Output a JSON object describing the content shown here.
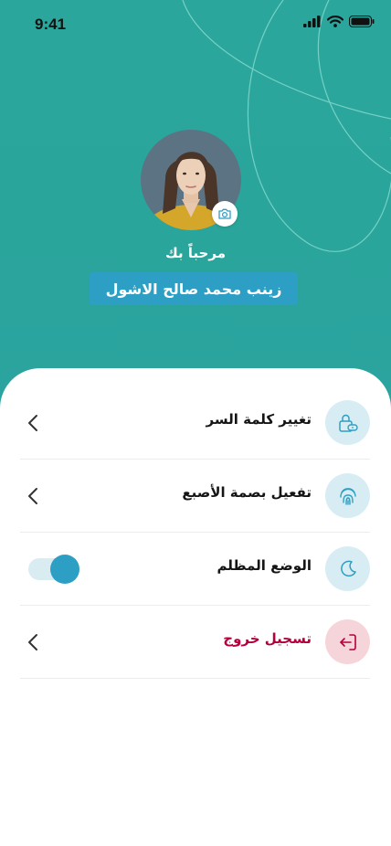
{
  "status_bar": {
    "time": "9:41"
  },
  "profile": {
    "welcome": "مرحباً بك",
    "name": "زينب محمد صالح الاشول"
  },
  "menu": {
    "items": [
      {
        "label": "تغيير كلمة السر",
        "icon": "lock-icon",
        "action": "chevron"
      },
      {
        "label": "تفعيل بصمة الأصبع",
        "icon": "fingerprint-icon",
        "action": "chevron"
      },
      {
        "label": "الوضع المظلم",
        "icon": "moon-icon",
        "action": "toggle",
        "toggle_on": true
      },
      {
        "label": "تسجيل خروج",
        "icon": "logout-icon",
        "action": "chevron"
      }
    ]
  },
  "colors": {
    "header": "#2aa59b",
    "accent": "#2e9fc4",
    "icon_bg": "#d8edf3",
    "danger": "#b4003c",
    "danger_bg": "#f6d5da"
  }
}
